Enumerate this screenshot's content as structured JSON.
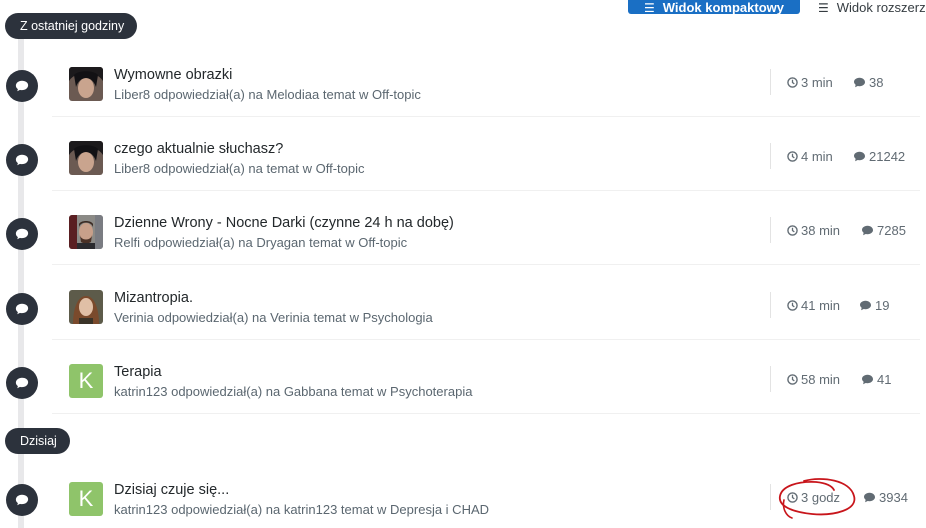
{
  "toolbar": {
    "compact_label": "Widok kompaktowy",
    "expanded_label": "Widok rozszerzony"
  },
  "sections": [
    {
      "label": "Z ostatniej godziny"
    },
    {
      "label": "Dzisiaj"
    }
  ],
  "items": [
    {
      "title": "Wymowne obrazki",
      "meta": "Liber8 odpowiedział(a) na Melodiaa temat w Off-topic",
      "time": "3 min",
      "count": "38",
      "avatar": "photo-dark"
    },
    {
      "title": "czego aktualnie słuchasz?",
      "meta": "Liber8 odpowiedział(a) na temat w Off-topic",
      "time": "4 min",
      "count": "21242",
      "avatar": "photo-dark"
    },
    {
      "title": "Dzienne Wrony - Nocne Darki (czynne 24 h na dobę)",
      "meta": "Relfi odpowiedział(a) na Dryagan temat w Off-topic",
      "time": "38 min",
      "count": "7285",
      "avatar": "photo-man"
    },
    {
      "title": "Mizantropia.",
      "meta": "Verinia odpowiedział(a) na Verinia temat w Psychologia",
      "time": "41 min",
      "count": "19",
      "avatar": "photo-woman"
    },
    {
      "title": "Terapia",
      "meta": "katrin123 odpowiedział(a) na Gabbana temat w Psychoterapia",
      "time": "58 min",
      "count": "41",
      "avatar": "K"
    },
    {
      "title": "Dzisiaj czuje się...",
      "meta": "katrin123 odpowiedział(a) na katrin123 temat w Depresja i CHAD",
      "time": "3 godz",
      "count": "3934",
      "avatar": "K"
    }
  ],
  "colors": {
    "accent": "#1a6fc4",
    "timeline_bullet": "#2c323c",
    "avatar_k": "#8fc46a",
    "annotation": "#c8151b"
  },
  "icons": {
    "compact": "list-icon",
    "expanded": "menu-icon",
    "bullet": "comment-icon",
    "time": "clock-icon",
    "count": "comment-icon"
  }
}
